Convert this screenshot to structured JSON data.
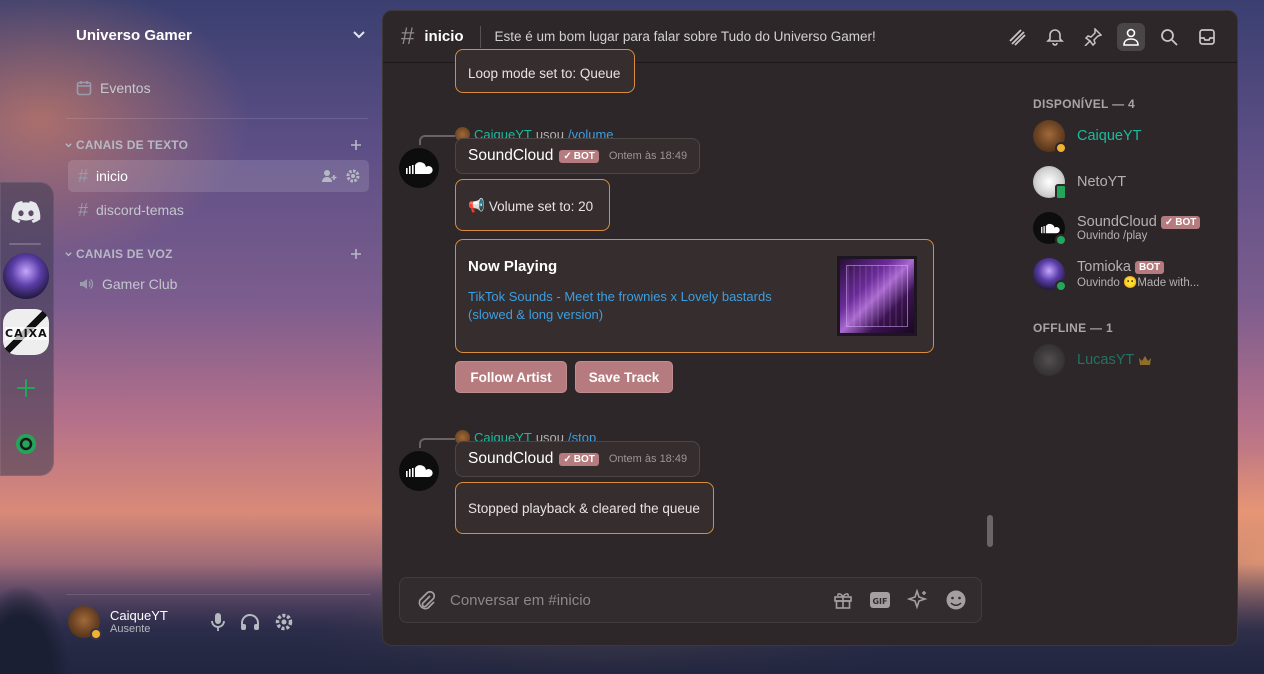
{
  "guild": {
    "name": "Universo Gamer",
    "events_label": "Eventos"
  },
  "categories": {
    "text": "CANAIS DE TEXTO",
    "voice": "CANAIS DE VOZ"
  },
  "channels": [
    {
      "name": "inicio"
    },
    {
      "name": "discord-temas"
    }
  ],
  "voice_channels": [
    {
      "name": "Gamer Club"
    }
  ],
  "user_panel": {
    "name": "CaiqueYT",
    "status": "Ausente"
  },
  "topbar": {
    "channel": "inicio",
    "topic": "Este é um bom lugar para falar sobre Tudo do Universo Gamer!"
  },
  "chat": {
    "loop_embed": "Loop mode set to: Queue",
    "msg1": {
      "reply_user": "CaiqueYT",
      "reply_used": "usou",
      "reply_cmd": "/volume",
      "author": "SoundCloud",
      "bot_tag": "BOT",
      "time": "Ontem às 18:49",
      "volume_text": "Volume set to: 20",
      "np_title": "Now Playing",
      "np_track": "TikTok Sounds - Meet the frownies x Lovely bastards (slowed & long version)",
      "btn_follow": "Follow Artist",
      "btn_save": "Save Track"
    },
    "msg2": {
      "reply_user": "CaiqueYT",
      "reply_used": "usou",
      "reply_cmd": "/stop",
      "author": "SoundCloud",
      "bot_tag": "BOT",
      "time": "Ontem às 18:49",
      "stop_text": "Stopped playback & cleared the queue"
    }
  },
  "composer": {
    "placeholder": "Conversar em #inicio"
  },
  "members": {
    "online_header": "DISPONÍVEL — 4",
    "offline_header": "OFFLINE — 1",
    "list": [
      {
        "name": "CaiqueYT",
        "sub": "",
        "color": "#1abc9c"
      },
      {
        "name": "NetoYT",
        "sub": "",
        "color": "#b5b0b2"
      },
      {
        "name": "SoundCloud",
        "sub": "Ouvindo /play",
        "bot": "BOT",
        "color": "#b5b0b2"
      },
      {
        "name": "Tomioka",
        "sub": "Ouvindo 😶Made with...",
        "bot": "BOT",
        "color": "#b5b0b2"
      }
    ],
    "offline": [
      {
        "name": "LucasYT",
        "color": "#1abc9c"
      }
    ]
  },
  "colors": {
    "accent": "#b57b7e",
    "embed_border": "#d98d3c",
    "link": "#3e9fdf",
    "teal": "#1abc9c"
  }
}
